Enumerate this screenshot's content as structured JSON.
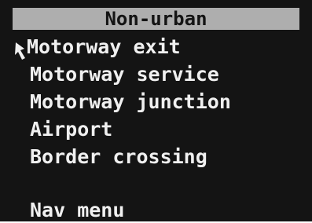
{
  "menu_title": "Non-urban",
  "items": [
    {
      "label": "Motorway exit"
    },
    {
      "label": "Motorway service"
    },
    {
      "label": "Motorway junction"
    },
    {
      "label": "Airport"
    },
    {
      "label": "Border crossing"
    }
  ],
  "nav_menu_label": "Nav menu",
  "selected_index": 0,
  "cursor_icon": "pointer-down-arrow-icon",
  "colors": {
    "background": "#141414",
    "title_bar": "#aeaeae",
    "text": "#f0f0f0"
  }
}
